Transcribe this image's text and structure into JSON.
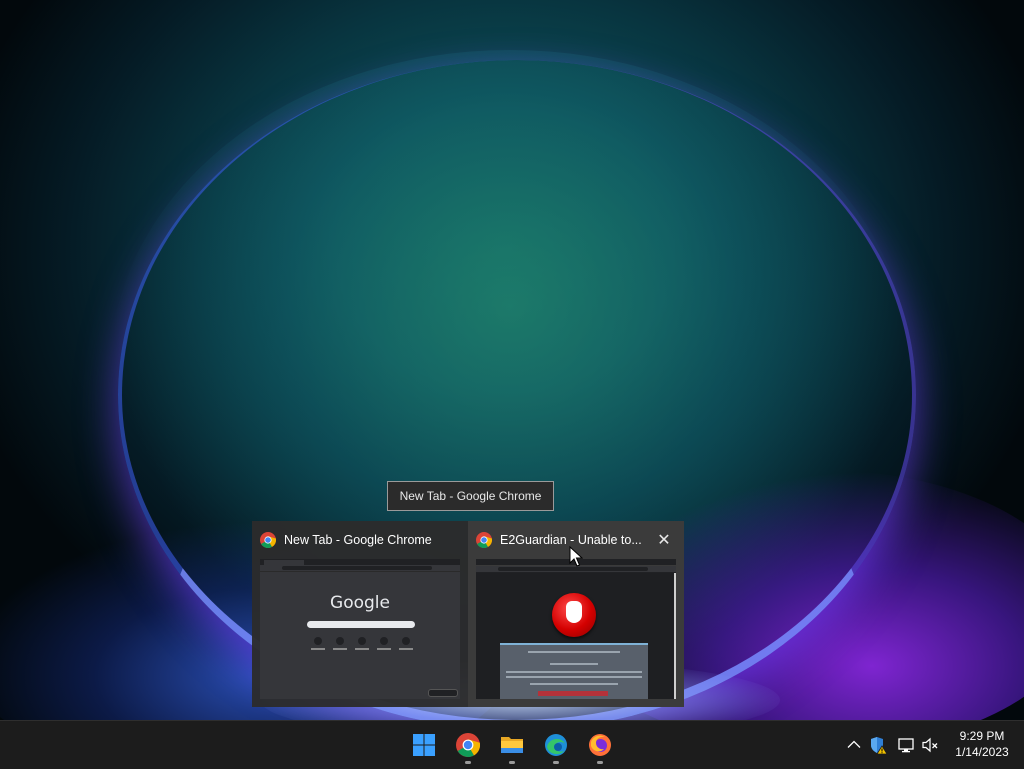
{
  "tooltip": {
    "text": "New Tab - Google Chrome"
  },
  "preview": {
    "items": [
      {
        "title": "New Tab - Google Chrome",
        "icon": "chrome-icon",
        "thumbnail": {
          "logo_text": "Google"
        }
      },
      {
        "title": "E2Guardian - Unable to...",
        "icon": "chrome-icon",
        "close_label": "✕",
        "hovered": true
      }
    ]
  },
  "taskbar": {
    "apps": [
      {
        "name": "start-button",
        "icon": "windows-logo-icon"
      },
      {
        "name": "google-chrome",
        "icon": "chrome-icon",
        "running": true
      },
      {
        "name": "file-explorer",
        "icon": "folder-icon",
        "running": true
      },
      {
        "name": "microsoft-edge",
        "icon": "edge-icon",
        "running": true
      },
      {
        "name": "firefox",
        "icon": "firefox-icon",
        "running": true
      }
    ],
    "tray": {
      "icons": [
        "chevron-up-icon",
        "defender-shield-warning-icon",
        "network-icon",
        "speaker-muted-icon"
      ]
    },
    "clock": {
      "time": "9:29 PM",
      "date": "1/14/2023"
    }
  },
  "colors": {
    "taskbar_bg": "#1c1c1c",
    "flyout_bg": "#2c2c2c",
    "hover_bg": "#3b3b3b",
    "accent_blue": "#3aa0ff"
  }
}
